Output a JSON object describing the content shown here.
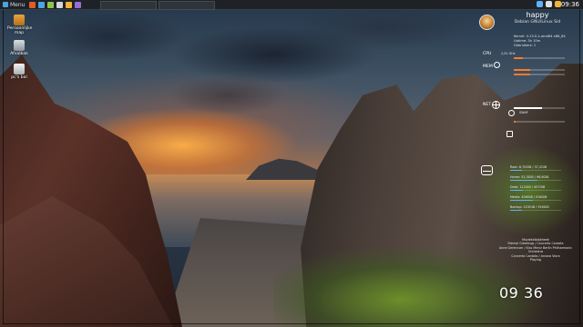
{
  "panel": {
    "menu_label": "Menu",
    "clock": "09:36",
    "colors": {
      "background": "#1e2226",
      "accent": "#4aa3e8"
    }
  },
  "desktop_icons": [
    {
      "label": "Persoonlijke map",
      "icon": "home-folder-icon"
    },
    {
      "label": "Afvalbak",
      "icon": "trash-icon"
    },
    {
      "label": "pc's bal",
      "icon": "computer-icon"
    }
  ],
  "conky": {
    "hostname": "happy",
    "os_line1": "Debian GNU/Linux Sid",
    "kernel": "Kernel: 4.13.0-1-amd64 x86_64",
    "uptime": "Uptime: 3h 10m",
    "users": "Gebruikers: 1",
    "cpu_label": "CPU",
    "cpu_value": "2,01 GHz",
    "cpu_percent": 0.18,
    "mem_label": "MEM",
    "mem_percent": 0.32,
    "net_label": "NET",
    "net_percent": 0.55,
    "swap_label": "SWAP",
    "swap_percent": 0.04,
    "fs_rows": [
      {
        "label": "Root: 8,70GiB / 37,2GiB",
        "percent": 0.23
      },
      {
        "label": "Home: 52,3GiB / 96,8GiB",
        "percent": 0.54
      },
      {
        "label": "Data: 112GiB / 457GiB",
        "percent": 0.25
      },
      {
        "label": "Media: 406GiB / 916GiB",
        "percent": 0.44
      },
      {
        "label": "Backup: 223GiB / 916GiB",
        "percent": 0.24
      }
    ],
    "music_lines": [
      "Muziekbibliotheek",
      "Eternal Greetings / Concerto Cantata",
      "Anne Gerencser / Kiss Mirror Berlin Philharmonic Orchestra",
      "Concerto Cantata / Arcana Viora",
      "Playing"
    ],
    "colors": {
      "cpu_bar": "#ff7a2a",
      "fs_bar": "#5fb0ff"
    }
  },
  "desktop_clock": {
    "time": "09 36"
  }
}
